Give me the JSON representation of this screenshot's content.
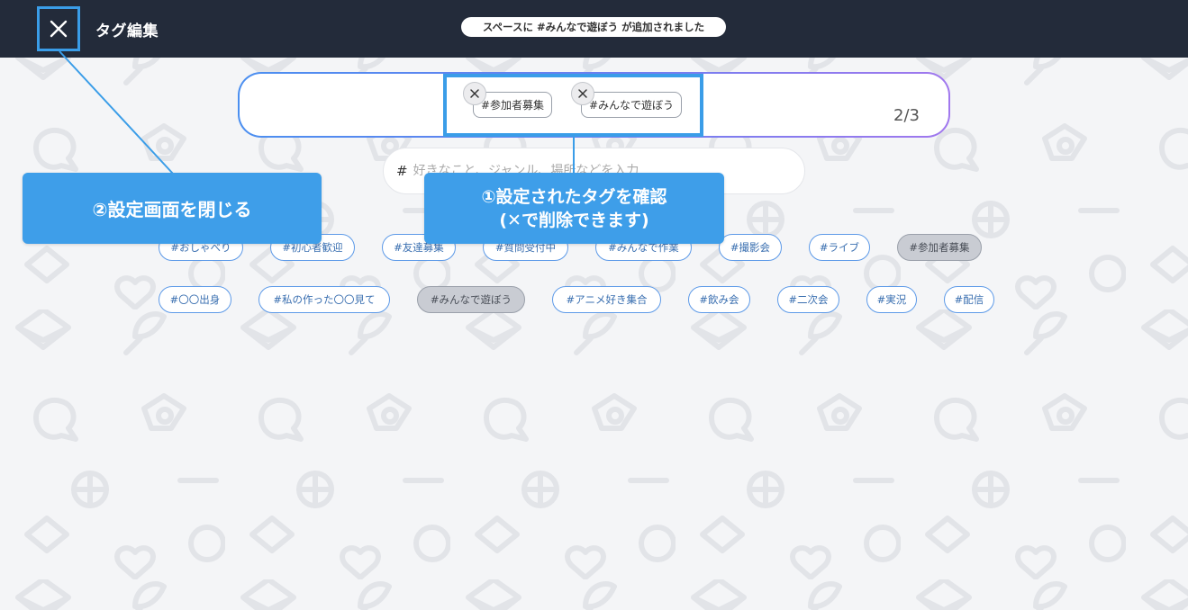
{
  "header": {
    "title": "タグ編集",
    "toast": "スペースに #みんなで遊ぼう が追加されました"
  },
  "selected": {
    "tags": [
      "#参加者募集",
      "#みんなで遊ぼう"
    ],
    "count": "2/3"
  },
  "input": {
    "placeholder": "好きなこと、ジャンル、場所などを入力",
    "hash": "#"
  },
  "suggestions": {
    "row1": [
      "#おしゃべり",
      "#初心者歓迎",
      "#友達募集",
      "#質問受付中",
      "#みんなで作業",
      "#撮影会",
      "#ライブ",
      "#参加者募集"
    ],
    "row2": [
      "#〇〇出身",
      "#私の作った〇〇見て",
      "#みんなで遊ぼう",
      "#アニメ好き集合",
      "#飲み会",
      "#二次会",
      "#実況",
      "#配信"
    ]
  },
  "annotations": {
    "left": "②設定画面を閉じる",
    "right_line1": "①設定されたタグを確認",
    "right_line2": "(✕で削除できます)"
  },
  "colors": {
    "header_bg": "#232b3a",
    "callout_bg": "#3e9ee9",
    "highlight_border": "#3a9de8",
    "chip_border": "#5d9ae8",
    "chip_active_bg": "#c9ccd3"
  }
}
